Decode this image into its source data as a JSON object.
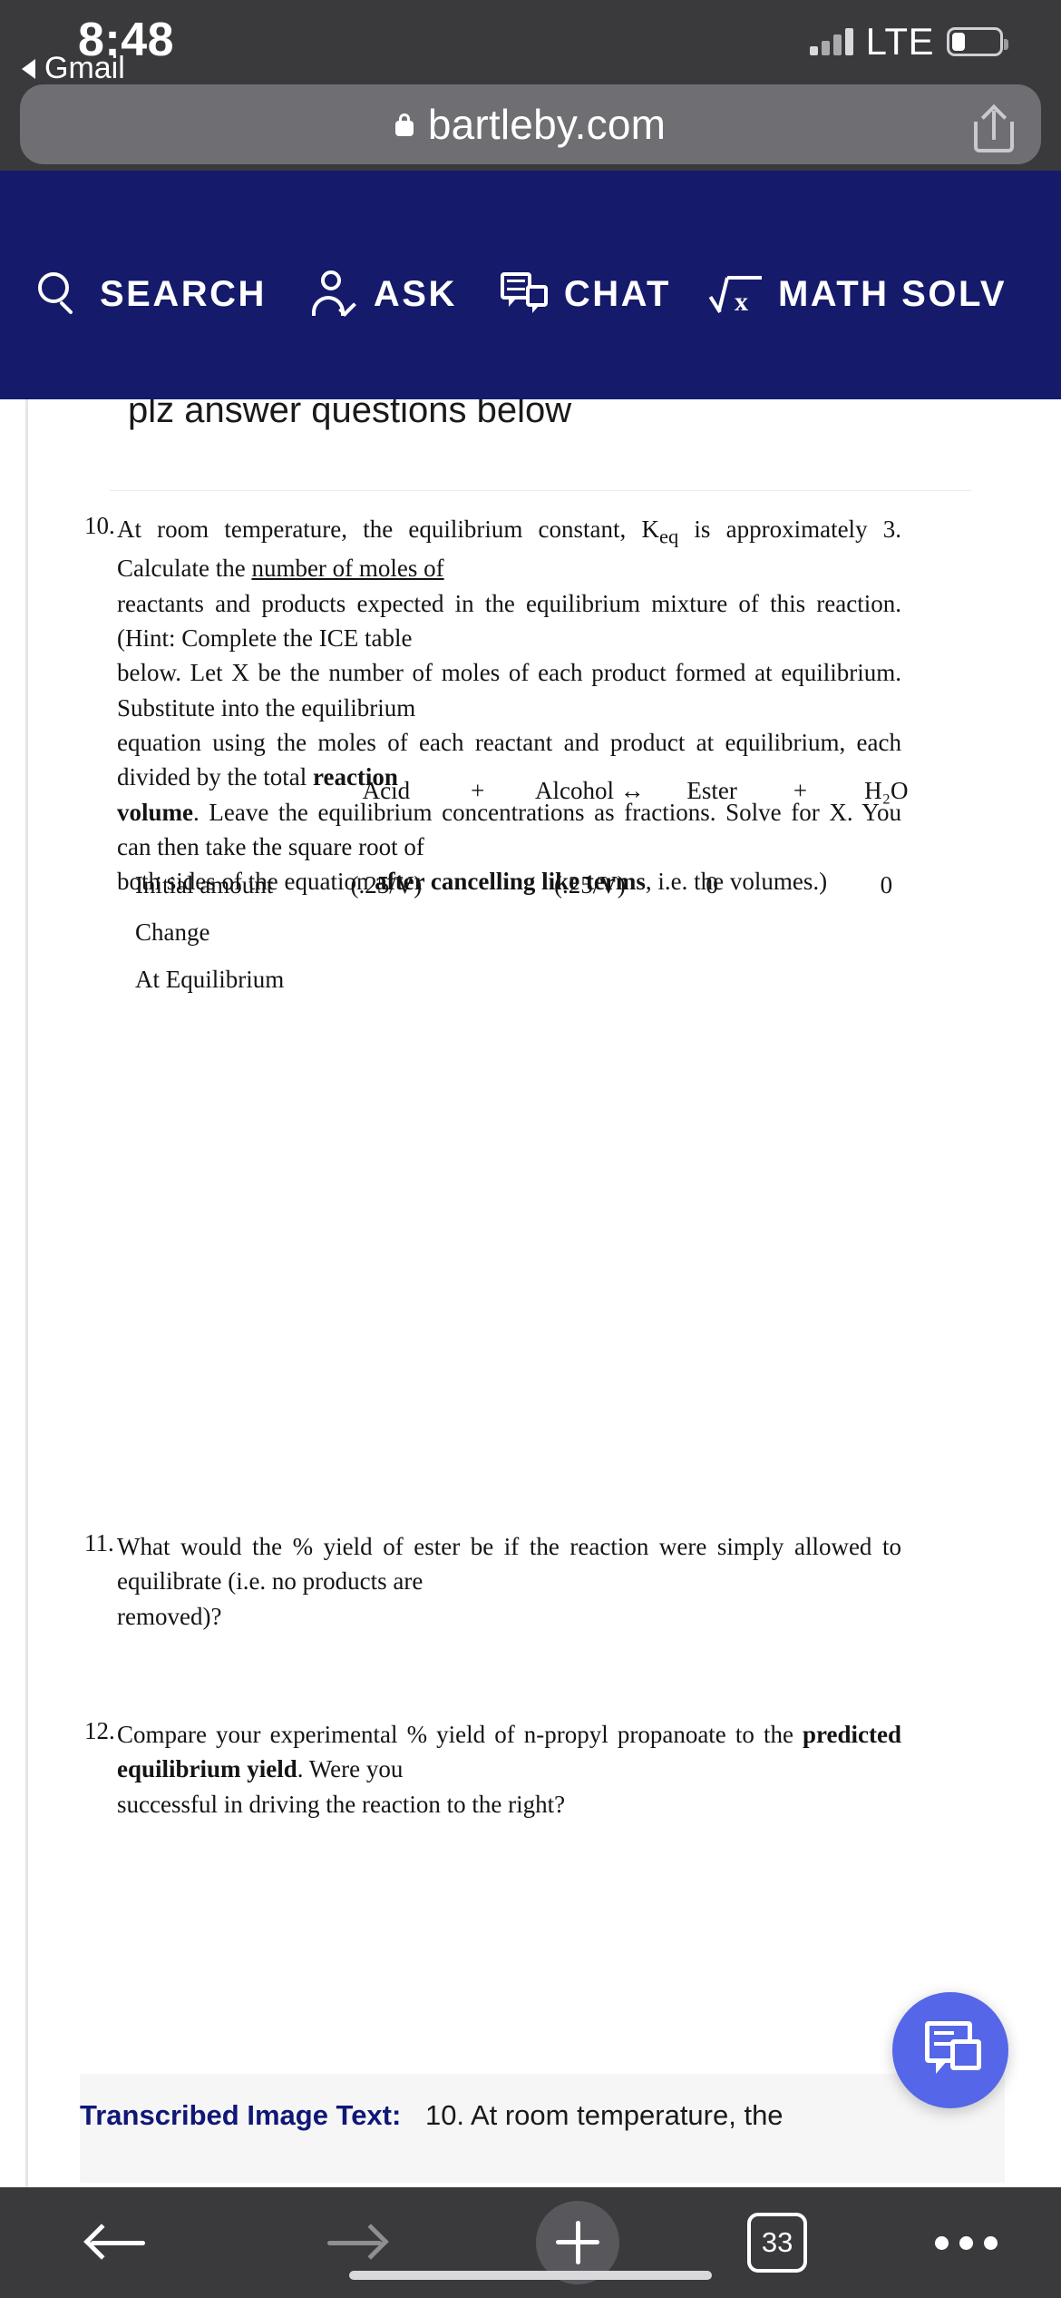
{
  "status_bar": {
    "time": "8:48",
    "carrier_tech": "LTE",
    "back_app_label": "Gmail",
    "back_arrow_icon": "triangle-left-icon",
    "signal_icon": "cellular-signal-icon",
    "battery_icon": "battery-icon"
  },
  "browser": {
    "url": "bartleby.com",
    "lock_icon": "lock-icon",
    "share_icon": "share-icon"
  },
  "site_nav": {
    "background_color": "#151a6b",
    "items": [
      {
        "label": "SEARCH",
        "icon": "search-icon"
      },
      {
        "label": "ASK",
        "icon": "person-check-icon"
      },
      {
        "label": "CHAT",
        "icon": "chat-bubbles-icon"
      },
      {
        "label": "MATH SOLV",
        "icon": "square-root-x-icon"
      }
    ]
  },
  "content": {
    "user_note": "plz answer questions below",
    "questions": [
      {
        "number": "10.",
        "lines": [
          "At room temperature, the equilibrium constant, K<sub>eq</sub> is approximately 3. Calculate the <span class=\"u\">number of moles of</span>",
          "reactants and products expected in the equilibrium mixture of this reaction. (Hint: Complete the ICE table",
          "below. Let X be the number of moles of each product formed at equilibrium. Substitute into the equilibrium",
          "equation using the moles of each reactant and product at equilibrium, each divided by the total <b>reaction</b>",
          "<b>volume</b>. Leave the equilibrium concentrations as fractions. Solve for X. You can then take the square root  of",
          "both sides of the equation <b>after cancelling like terms</b>, i.e. the volumes.)"
        ]
      },
      {
        "number": "11.",
        "lines": [
          "What would the % yield of ester be if the reaction were simply allowed to equilibrate (i.e. no products are",
          "removed)?"
        ]
      },
      {
        "number": "12.",
        "lines": [
          "Compare your experimental % yield of n-propyl propanoate to the <b>predicted equilibrium yield</b>. Were you",
          "successful in driving the reaction to the right?"
        ]
      }
    ],
    "ice_table": {
      "header": [
        "",
        "Acid",
        "+",
        "Alcohol ↔",
        "Ester",
        "+",
        "H₂O"
      ],
      "rows": [
        {
          "label": "Initial amount",
          "cells": [
            "(.25/V)",
            "",
            "(.25/V)",
            "0",
            "",
            "0"
          ]
        },
        {
          "label": "Change",
          "cells": [
            "",
            "",
            "",
            "",
            "",
            ""
          ]
        },
        {
          "label": "At Equilibrium",
          "cells": [
            "",
            "",
            "",
            "",
            "",
            ""
          ]
        }
      ]
    },
    "transcribed": {
      "label": "Transcribed Image Text:",
      "text": "10. At room temperature, the"
    },
    "fab_icon": "chat-bubbles-icon",
    "fab_color": "#5566e8"
  },
  "toolbar": {
    "back_icon": "arrow-left-icon",
    "forward_icon": "arrow-right-icon",
    "new_tab_icon": "plus-icon",
    "tabs_count": "33",
    "more_icon": "ellipsis-icon"
  }
}
